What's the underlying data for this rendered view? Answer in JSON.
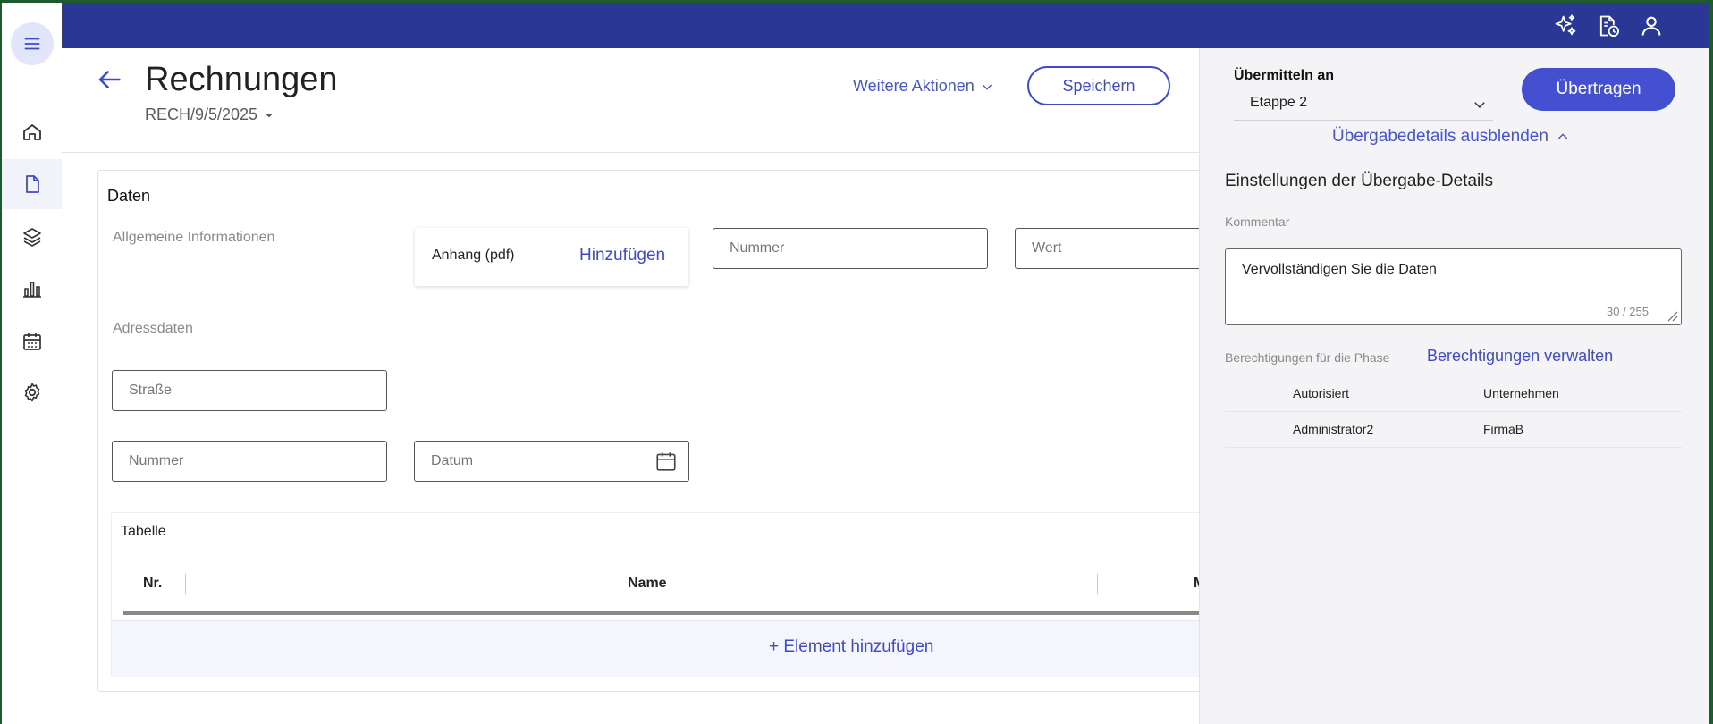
{
  "header": {
    "title": "Rechnungen",
    "doc_id": "RECH/9/5/2025",
    "more_actions": "Weitere Aktionen",
    "save": "Speichern"
  },
  "card": {
    "title": "Daten",
    "general_info": "Allgemeine Informationen",
    "attachment_label": "Anhang (pdf)",
    "attachment_add": "Hinzufügen",
    "field_number_top": "Nummer",
    "field_value": "Wert",
    "address_data": "Adressdaten",
    "field_street": "Straße",
    "field_number": "Nummer",
    "field_date": "Datum"
  },
  "table": {
    "title": "Tabelle",
    "columns": [
      "Nr.",
      "Name",
      "M"
    ],
    "add_item": "+ Element hinzufügen"
  },
  "panel": {
    "submit_to_label": "Übermitteln an",
    "stage_value": "Etappe 2",
    "transfer": "Übertragen",
    "hide_details": "Übergabedetails ausblenden",
    "settings_heading": "Einstellungen der Übergabe-Details",
    "comment_label": "Kommentar",
    "comment_value": "Vervollständigen Sie die Daten",
    "comment_count": "30 / 255",
    "permissions_label": "Berechtigungen für die Phase",
    "manage_permissions": "Berechtigungen verwalten",
    "permissions_header": [
      "Autorisiert",
      "Unternehmen"
    ],
    "permissions_rows": [
      [
        "Administrator2",
        "FirmaB"
      ]
    ]
  },
  "icons": {
    "rail": [
      "menu-icon",
      "home-icon",
      "document-icon",
      "layers-icon",
      "bar-chart-icon",
      "calendar-icon",
      "gear-icon"
    ],
    "topbar": [
      "sparkle-icon",
      "document-clock-icon",
      "user-icon"
    ]
  },
  "colors": {
    "topbar": "#2b3795",
    "accent": "#3e4bc7",
    "panel_bg": "#f4f4f6"
  }
}
